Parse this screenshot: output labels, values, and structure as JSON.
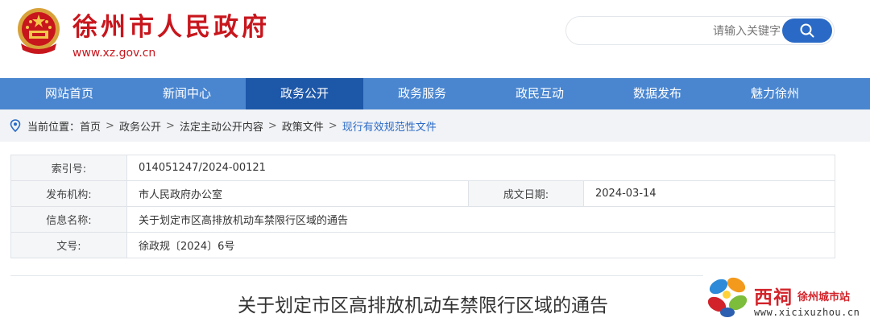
{
  "header": {
    "title": "徐州市人民政府",
    "url": "www.xz.gov.cn",
    "search_placeholder": "请输入关键字",
    "brand_color": "#c8161d"
  },
  "nav": {
    "items": [
      "网站首页",
      "新闻中心",
      "政务公开",
      "政务服务",
      "政民互动",
      "数据发布",
      "魅力徐州"
    ],
    "active_index": 2,
    "bar_color": "#4a86d0",
    "active_color": "#1d57a8"
  },
  "breadcrumb": {
    "prefix": "当前位置：",
    "items": [
      "首页",
      "政务公开",
      "法定主动公开内容",
      "政策文件",
      "现行有效规范性文件"
    ],
    "separator": ">"
  },
  "info": {
    "index_label": "索引号:",
    "index_value": "014051247/2024-00121",
    "publisher_label": "发布机构:",
    "publisher_value": "市人民政府办公室",
    "date_label": "成文日期:",
    "date_value": "2024-03-14",
    "name_label": "信息名称:",
    "name_value": "关于划定市区高排放机动车禁限行区域的通告",
    "doc_label": "文号:",
    "doc_value": "徐政规〔2024〕6号"
  },
  "article": {
    "title": "关于划定市区高排放机动车禁限行区域的通告"
  },
  "watermark": {
    "chars": "西祠",
    "sub": "徐州城市站",
    "url": "www.xicixuzhou.cn"
  }
}
